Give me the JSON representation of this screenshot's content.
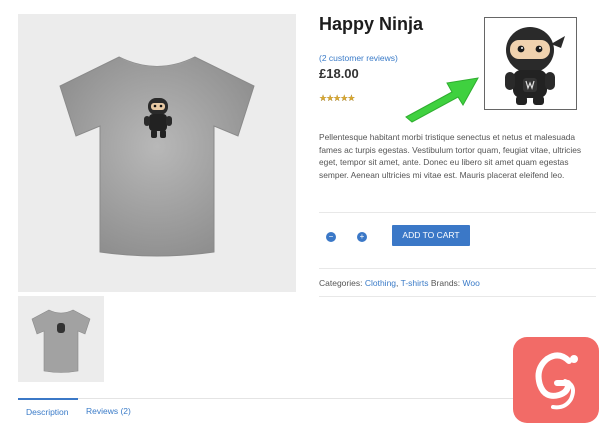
{
  "product": {
    "title": "Happy Ninja",
    "reviews_link": "(2 customer reviews)",
    "price": "£18.00",
    "rating": 5,
    "rating_max": 5,
    "description": "Pellentesque habitant morbi tristique senectus et netus et malesuada fames ac turpis egestas. Vestibulum tortor quam, feugiat vitae, ultricies eget, tempor sit amet, ante. Donec eu libero sit amet quam egestas semper. Aenean ultricies mi vitae est. Mauris placerat eleifend leo."
  },
  "cart": {
    "minus_symbol": "−",
    "plus_symbol": "+",
    "add_to_cart_label": "ADD TO CART"
  },
  "meta": {
    "categories_label": "Categories:",
    "category_1": "Clothing",
    "separator": ",",
    "category_2": "T-shirts",
    "brands_label": "Brands:",
    "brand": "Woo"
  },
  "tabs": {
    "description": "Description",
    "reviews": "Reviews (2)"
  },
  "icons": {
    "star": "star-icon",
    "arrow": "green-arrow-icon",
    "logo": "logo-badge-icon"
  },
  "colors": {
    "accent": "#3b78c7",
    "link": "#3a7bc8",
    "arrow": "#3fd13f",
    "logo_bg": "#f26b67",
    "star": "#d8a730"
  }
}
